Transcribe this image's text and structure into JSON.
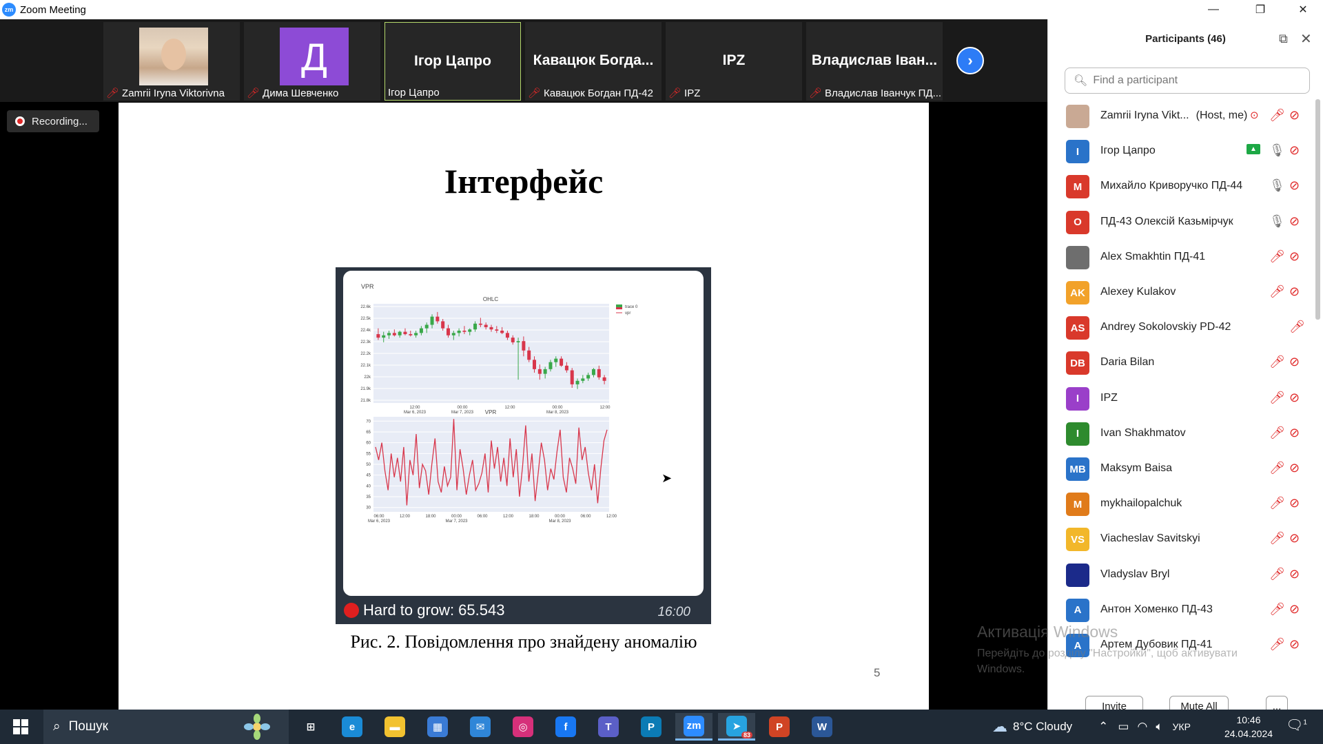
{
  "window": {
    "app_logo_text": "zm",
    "title": "Zoom Meeting",
    "minimize_icon": "minimize-icon",
    "restore_icon": "restore-icon",
    "close_icon": "close-icon"
  },
  "video_strip": {
    "tiles": [
      {
        "display": "photo",
        "label": "Zamrii Iryna Viktorivna",
        "muted": true
      },
      {
        "display": "avatar",
        "avatar_letter": "Д",
        "avatar_color": "#8d4bd6",
        "label": "Дима Шевченко",
        "muted": true
      },
      {
        "display": "name",
        "big_name": "Ігор Цапро",
        "label": "Ігор Цапро",
        "muted": false,
        "active": true
      },
      {
        "display": "name",
        "big_name": "Кавацюк Богда...",
        "label": "Кавацюк Богдан ПД-42",
        "muted": true
      },
      {
        "display": "name",
        "big_name": "IPZ",
        "label": "IPZ",
        "muted": true
      },
      {
        "display": "name",
        "big_name": "Владислав Іван...",
        "label": "Владислав Іванчук ПД...",
        "muted": true
      }
    ],
    "next_icon": "chevron-right-icon"
  },
  "recording": {
    "label": "Recording..."
  },
  "slide": {
    "title": "Інтерфейс",
    "caption": "Рис. 2. Повідомлення про знайдену аномалію",
    "page_number": "5",
    "message": {
      "alert_text": "Hard to grow: 65.543",
      "time": "16:00",
      "chart_header": "VPR",
      "chart_data": [
        {
          "type": "candlestick",
          "title": "OHLC",
          "legend": [
            "trace 0",
            "vpr"
          ],
          "y_ticks": [
            "22.6k",
            "22.5k",
            "22.4k",
            "22.3k",
            "22.2k",
            "22.1k",
            "22k",
            "21.9k",
            "21.8k"
          ],
          "ylim": [
            21800,
            22650
          ],
          "x_ticks": [
            "12:00\nMar 6, 2023",
            "00:00\nMar 7, 2023",
            "12:00",
            "00:00\nMar 8, 2023",
            "12:00"
          ],
          "candles": [
            [
              22390,
              22440,
              22340,
              22360
            ],
            [
              22360,
              22410,
              22320,
              22380
            ],
            [
              22380,
              22420,
              22350,
              22400
            ],
            [
              22400,
              22430,
              22370,
              22380
            ],
            [
              22380,
              22420,
              22360,
              22410
            ],
            [
              22410,
              22440,
              22380,
              22390
            ],
            [
              22390,
              22420,
              22370,
              22380
            ],
            [
              22380,
              22420,
              22360,
              22400
            ],
            [
              22400,
              22460,
              22380,
              22440
            ],
            [
              22440,
              22490,
              22400,
              22470
            ],
            [
              22470,
              22560,
              22440,
              22540
            ],
            [
              22540,
              22580,
              22480,
              22500
            ],
            [
              22500,
              22520,
              22420,
              22440
            ],
            [
              22440,
              22470,
              22360,
              22380
            ],
            [
              22380,
              22420,
              22340,
              22400
            ],
            [
              22400,
              22440,
              22370,
              22420
            ],
            [
              22420,
              22460,
              22390,
              22410
            ],
            [
              22410,
              22440,
              22380,
              22430
            ],
            [
              22430,
              22500,
              22410,
              22480
            ],
            [
              22480,
              22530,
              22450,
              22470
            ],
            [
              22470,
              22490,
              22430,
              22450
            ],
            [
              22450,
              22470,
              22410,
              22430
            ],
            [
              22430,
              22460,
              22400,
              22420
            ],
            [
              22420,
              22450,
              22390,
              22400
            ],
            [
              22400,
              22420,
              22340,
              22360
            ],
            [
              22360,
              22380,
              22300,
              22320
            ],
            [
              22320,
              22360,
              22000,
              22330
            ],
            [
              22330,
              22370,
              22200,
              22250
            ],
            [
              22250,
              22280,
              22150,
              22170
            ],
            [
              22170,
              22200,
              22060,
              22090
            ],
            [
              22090,
              22130,
              22000,
              22050
            ],
            [
              22050,
              22110,
              22010,
              22090
            ],
            [
              22090,
              22170,
              22070,
              22150
            ],
            [
              22150,
              22200,
              22110,
              22180
            ],
            [
              22180,
              22200,
              22110,
              22120
            ],
            [
              22120,
              22150,
              22060,
              22080
            ],
            [
              22080,
              22100,
              21930,
              21960
            ],
            [
              21960,
              22010,
              21920,
              21990
            ],
            [
              21990,
              22040,
              21970,
              22010
            ],
            [
              22010,
              22060,
              21990,
              22040
            ],
            [
              22040,
              22100,
              22020,
              22090
            ],
            [
              22090,
              22120,
              22000,
              22020
            ],
            [
              22020,
              22040,
              21960,
              21990
            ]
          ]
        },
        {
          "type": "line",
          "title": "VPR",
          "y_ticks": [
            "70",
            "65",
            "60",
            "55",
            "50",
            "45",
            "40",
            "35",
            "30"
          ],
          "ylim": [
            28,
            72
          ],
          "x_ticks": [
            "06:00\nMar 6, 2023",
            "12:00",
            "18:00",
            "00:00\nMar 7, 2023",
            "06:00",
            "12:00",
            "18:00",
            "00:00\nMar 8, 2023",
            "06:00",
            "12:00"
          ],
          "values": [
            58,
            52,
            60,
            47,
            38,
            55,
            44,
            53,
            42,
            58,
            31,
            52,
            45,
            64,
            39,
            50,
            47,
            36,
            50,
            62,
            42,
            37,
            49,
            40,
            44,
            71,
            38,
            57,
            48,
            36,
            45,
            52,
            38,
            41,
            46,
            55,
            37,
            61,
            48,
            58,
            42,
            53,
            40,
            62,
            44,
            57,
            35,
            49,
            68,
            42,
            55,
            33,
            46,
            60,
            52,
            38,
            48,
            43,
            56,
            66,
            44,
            37,
            53,
            48,
            41,
            67,
            52,
            58,
            46,
            38,
            50,
            32,
            48,
            61,
            66
          ]
        }
      ]
    }
  },
  "participants": {
    "title": "Participants (46)",
    "popout_icon": "popout-icon",
    "close_icon": "close-icon",
    "search_placeholder": "Find a participant",
    "list": [
      {
        "initials": "",
        "photo": true,
        "color": "#c9a994",
        "name": "Zamrii Iryna Vikt...",
        "suffix": "(Host, me)",
        "recording": true,
        "mic": "muted",
        "cam": "off"
      },
      {
        "initials": "I",
        "color": "#2a73c9",
        "name": "Ігор Цапро",
        "sharing": true,
        "mic": "on",
        "cam": "off"
      },
      {
        "initials": "M",
        "color": "#d9392b",
        "name": "Михайло Криворучко ПД-44",
        "mic": "on",
        "cam": "off"
      },
      {
        "initials": "О",
        "color": "#d9392b",
        "name": "ПД-43 Олексій Казьмірчук",
        "mic": "on",
        "cam": "off"
      },
      {
        "initials": "",
        "photo": true,
        "color": "#6e6e6e",
        "name": "Alex Smakhtin ПД-41",
        "mic": "muted",
        "cam": "off"
      },
      {
        "initials": "AK",
        "color": "#f2a22a",
        "name": "Alexey Kulakov",
        "mic": "muted",
        "cam": "off"
      },
      {
        "initials": "AS",
        "color": "#d9392b",
        "name": "Andrey Sokolovskiy PD-42",
        "mic": "muted",
        "cam": "none"
      },
      {
        "initials": "DB",
        "color": "#d9392b",
        "name": "Daria Bilan",
        "mic": "muted",
        "cam": "off"
      },
      {
        "initials": "I",
        "color": "#9a3fc9",
        "name": "IPZ",
        "mic": "muted",
        "cam": "off"
      },
      {
        "initials": "I",
        "color": "#2e8b2e",
        "name": "Ivan Shakhmatov",
        "mic": "muted",
        "cam": "off"
      },
      {
        "initials": "MB",
        "color": "#2a73c9",
        "name": "Maksym Baisa",
        "mic": "muted",
        "cam": "off"
      },
      {
        "initials": "M",
        "color": "#e07b1a",
        "name": "mykhailopalchuk",
        "mic": "muted",
        "cam": "off"
      },
      {
        "initials": "VS",
        "color": "#f2b72a",
        "name": "Viacheslav Savitskyi",
        "mic": "muted",
        "cam": "off"
      },
      {
        "initials": "",
        "photo": true,
        "color": "#1b2a8a",
        "name": "Vladyslav Bryl",
        "mic": "muted",
        "cam": "off"
      },
      {
        "initials": "A",
        "color": "#2a73c9",
        "name": "Антон Хоменко ПД-43",
        "mic": "muted",
        "cam": "off"
      },
      {
        "initials": "A",
        "color": "#2a73c9",
        "name": "Артем Дубовик ПД-41",
        "mic": "muted",
        "cam": "off"
      }
    ],
    "invite_label": "Invite",
    "mute_all_label": "Mute All",
    "more_label": "..."
  },
  "watermark": {
    "title": "Активація Windows",
    "text": "Перейдіть до розділу \"Настройки\", щоб активувати Windows."
  },
  "taskbar": {
    "search_label": "Пошук",
    "apps": [
      {
        "name": "task-view",
        "glyph": "⊞",
        "color": "transparent"
      },
      {
        "name": "edge",
        "glyph": "e",
        "color": "#1a8bd6"
      },
      {
        "name": "file-explorer",
        "glyph": "▬",
        "color": "#f2c230"
      },
      {
        "name": "store",
        "glyph": "▦",
        "color": "#3a7bd5"
      },
      {
        "name": "mail",
        "glyph": "✉",
        "color": "#2f86d8"
      },
      {
        "name": "instagram",
        "glyph": "◎",
        "color": "#d6307a"
      },
      {
        "name": "facebook",
        "glyph": "f",
        "color": "#1877f2"
      },
      {
        "name": "teams",
        "glyph": "T",
        "color": "#5b5fc7"
      },
      {
        "name": "pearson",
        "glyph": "P",
        "color": "#0b7bb5"
      },
      {
        "name": "zoom",
        "glyph": "zm",
        "color": "#2d8cff"
      },
      {
        "name": "telegram",
        "glyph": "➤",
        "color": "#27a3e0",
        "badge": "83"
      },
      {
        "name": "powerpoint",
        "glyph": "P",
        "color": "#d04424"
      },
      {
        "name": "word",
        "glyph": "W",
        "color": "#2b5797"
      }
    ],
    "weather": "8°C  Cloudy",
    "language": "УКР",
    "time": "10:46",
    "date": "24.04.2024",
    "notification_count": "1"
  }
}
